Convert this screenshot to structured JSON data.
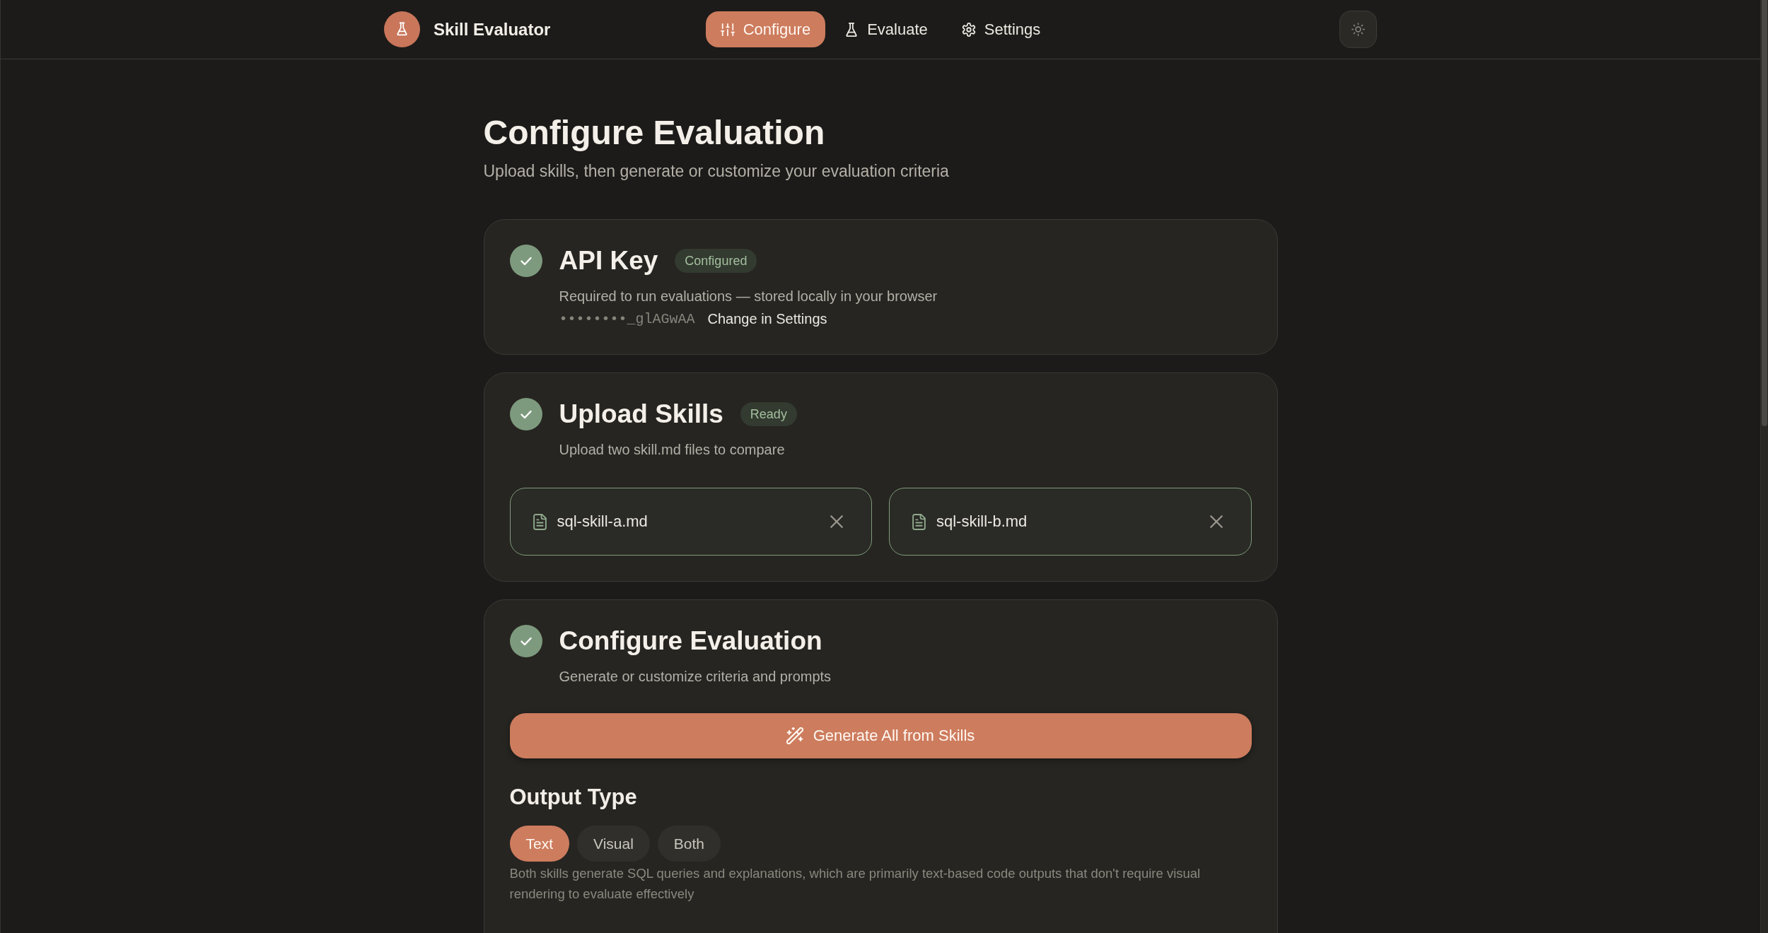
{
  "header": {
    "app_name": "Skill Evaluator",
    "nav": [
      {
        "label": "Configure",
        "kind": "configure",
        "selected": true
      },
      {
        "label": "Evaluate",
        "kind": "evaluate",
        "selected": false
      },
      {
        "label": "Settings",
        "kind": "settings",
        "selected": false
      }
    ]
  },
  "page": {
    "title": "Configure Evaluation",
    "subtitle": "Upload skills, then generate or customize your evaluation criteria"
  },
  "sections": [
    {
      "kind": "api_key",
      "done": true,
      "title": "API Key",
      "badge": "Configured",
      "description": "Required to run evaluations — stored locally in your browser",
      "masked_key": "••••••••_glAGwAA",
      "settings_link": "Change in Settings"
    },
    {
      "kind": "upload",
      "done": true,
      "title": "Upload Skills",
      "badge": "Ready",
      "description": "Upload two skill.md files to compare",
      "files": [
        {
          "name": "sql-skill-a.md"
        },
        {
          "name": "sql-skill-b.md"
        }
      ]
    },
    {
      "kind": "configure",
      "done": true,
      "title": "Configure Evaluation",
      "description": "Generate or customize criteria and prompts",
      "generate_button": "Generate All from Skills",
      "output_type": {
        "heading": "Output Type",
        "options": [
          {
            "label": "Text",
            "selected": true
          },
          {
            "label": "Visual",
            "selected": false
          },
          {
            "label": "Both",
            "selected": false
          }
        ],
        "explanation": "Both skills generate SQL queries and explanations, which are primarily text-based code outputs that don't require visual rendering to evaluate effectively"
      }
    }
  ]
}
